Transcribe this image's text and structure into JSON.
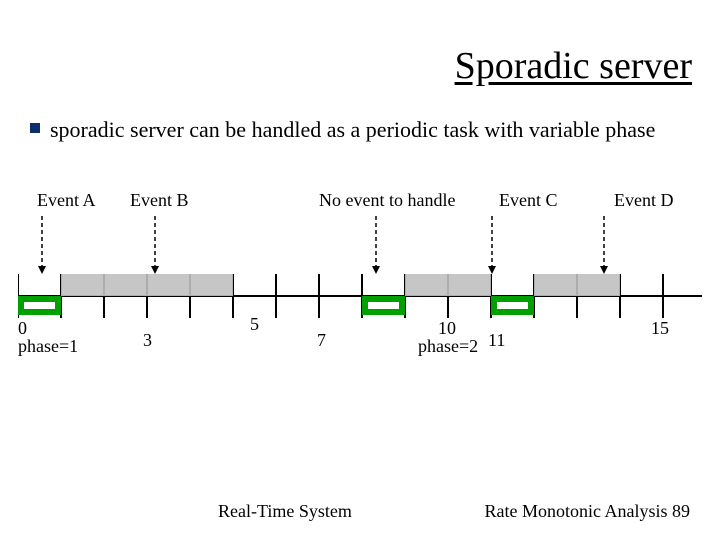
{
  "title": "Sporadic server",
  "bullet": "sporadic server can be handled as a periodic task with variable phase",
  "events": {
    "a": "Event A",
    "b": "Event B",
    "no_event": "No event to handle",
    "c": "Event C",
    "d": "Event D"
  },
  "axis_labels": {
    "zero": "0",
    "phase1": "phase=1",
    "three": "3",
    "five": "5",
    "seven": "7",
    "ten": "10",
    "phase2": "phase=2",
    "eleven": "11",
    "fifteen": "15"
  },
  "footer": {
    "left": "Real-Time System",
    "right": "Rate Monotonic Analysis 89"
  },
  "chart_data": {
    "type": "timeline",
    "title": "Sporadic server execution timeline",
    "x_range": [
      0,
      15
    ],
    "tick_interval": 1,
    "events": [
      {
        "name": "Event A",
        "time": 0.5
      },
      {
        "name": "Event B",
        "time": 3.2
      },
      {
        "name": "No event to handle",
        "time": 8.3
      },
      {
        "name": "Event C",
        "time": 11.0
      },
      {
        "name": "Event D",
        "time": 13.6
      }
    ],
    "executions_green": [
      {
        "start": 0,
        "end": 1
      },
      {
        "start": 8,
        "end": 9
      },
      {
        "start": 11,
        "end": 12
      }
    ],
    "executions_grey": [
      {
        "start": 1,
        "end": 3
      },
      {
        "start": 3,
        "end": 5
      },
      {
        "start": 9,
        "end": 11
      },
      {
        "start": 12,
        "end": 14
      }
    ],
    "phase_annotations": [
      {
        "at": 0,
        "text": "phase=1"
      },
      {
        "at": 10,
        "text": "phase=2"
      }
    ],
    "numbered_points": [
      0,
      3,
      5,
      7,
      10,
      11,
      15
    ]
  }
}
